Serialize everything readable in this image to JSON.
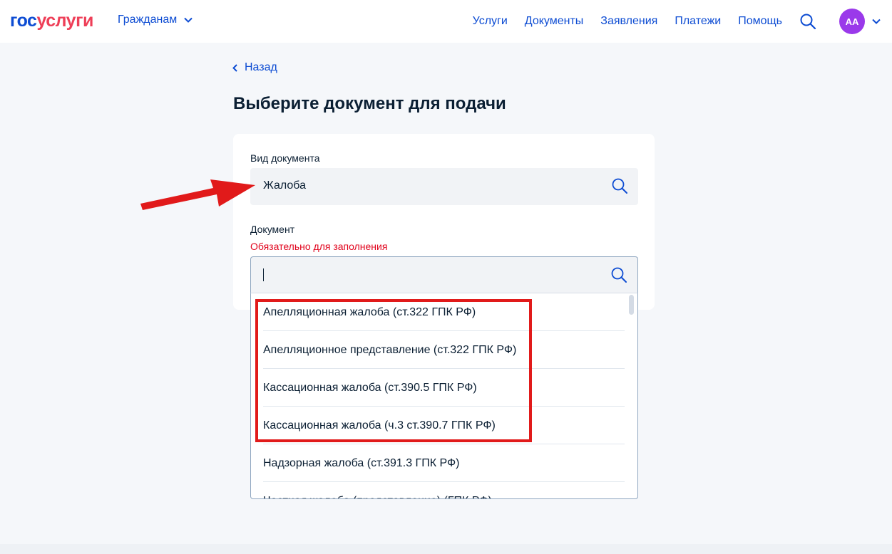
{
  "header": {
    "logo_part1": "гос",
    "logo_part2": "услуги",
    "audience_label": "Гражданам",
    "nav": [
      {
        "label": "Услуги"
      },
      {
        "label": "Документы"
      },
      {
        "label": "Заявления"
      },
      {
        "label": "Платежи"
      },
      {
        "label": "Помощь"
      }
    ],
    "avatar_initials": "АА"
  },
  "back_label": "Назад",
  "page_title": "Выберите документ для подачи",
  "doc_type": {
    "label": "Вид документа",
    "value": "Жалоба"
  },
  "document": {
    "label": "Документ",
    "required_text": "Обязательно для заполнения",
    "value": "",
    "options": [
      {
        "label": "Апелляционная жалоба (ст.322 ГПК РФ)"
      },
      {
        "label": "Апелляционное представление (ст.322 ГПК РФ)"
      },
      {
        "label": "Кассационная жалоба (ст.390.5 ГПК РФ)"
      },
      {
        "label": "Кассационная жалоба (ч.3 ст.390.7 ГПК РФ)"
      },
      {
        "label": "Надзорная жалоба (ст.391.3 ГПК РФ)"
      },
      {
        "label": "Частная жалоба (представление) (ГПК РФ)"
      }
    ]
  },
  "colors": {
    "brand_blue": "#0d4cd3",
    "brand_red": "#ee3f58",
    "annotation_red": "#e11a1a",
    "required_red": "#e1051e",
    "avatar_purple": "#9a39ea"
  }
}
